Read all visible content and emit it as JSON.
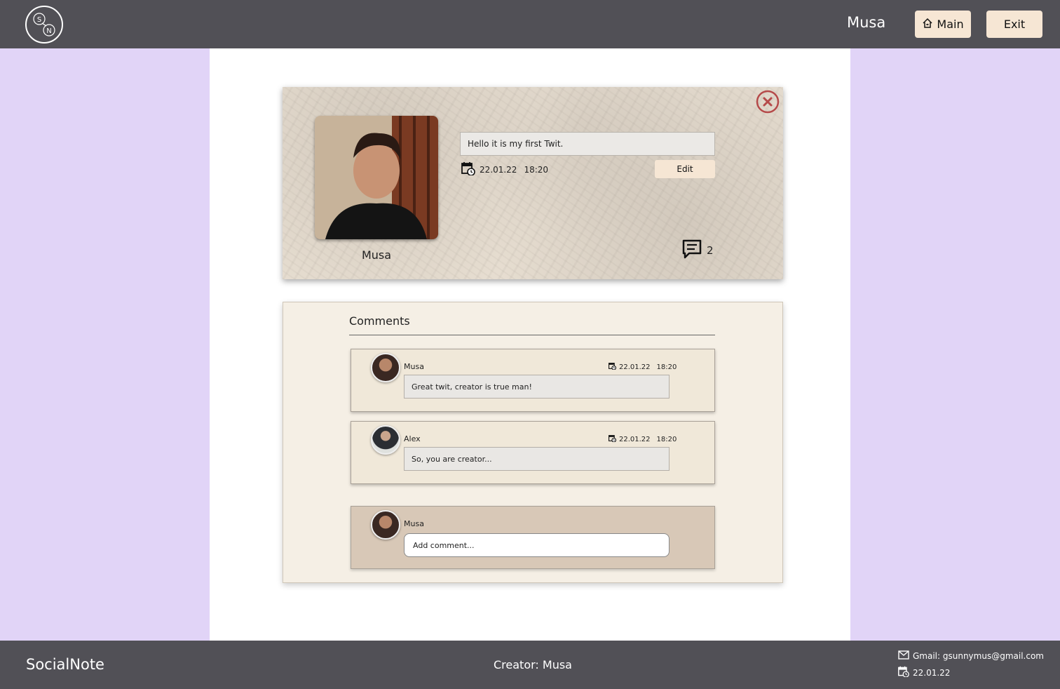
{
  "header": {
    "logo_letters": [
      "S",
      "N"
    ],
    "username": "Musa",
    "main_button_label": "Main",
    "exit_button_label": "Exit"
  },
  "twit": {
    "author": "Musa",
    "text": "Hello it is my first Twit.",
    "date": "22.01.22",
    "time": "18:20",
    "edit_label": "Edit",
    "comment_count": "2"
  },
  "comments": {
    "title": "Comments",
    "items": [
      {
        "author": "Musa",
        "date": "22.01.22",
        "time": "18:20",
        "text": "Great twit, creator is true man!"
      },
      {
        "author": "Alex",
        "date": "22.01.22",
        "time": "18:20",
        "text": "So, you are creator..."
      }
    ],
    "new_comment": {
      "author": "Musa",
      "placeholder": "Add comment..."
    }
  },
  "footer": {
    "brand": "SocialNote",
    "creator": "Creator: Musa",
    "email": "Gmail: gsunnymus@gmail.com",
    "date": "22.01.22"
  },
  "colors": {
    "header_bg": "#515056",
    "page_bg": "#e1d4f7",
    "button_bg": "#f6e6d4",
    "close_red": "#b54a4a"
  },
  "icons": {
    "logo": "sn-logo-icon",
    "main": "home-icon",
    "close": "close-circle-icon",
    "calendar": "calendar-clock-icon",
    "comments": "comment-icon",
    "email": "mail-icon"
  }
}
